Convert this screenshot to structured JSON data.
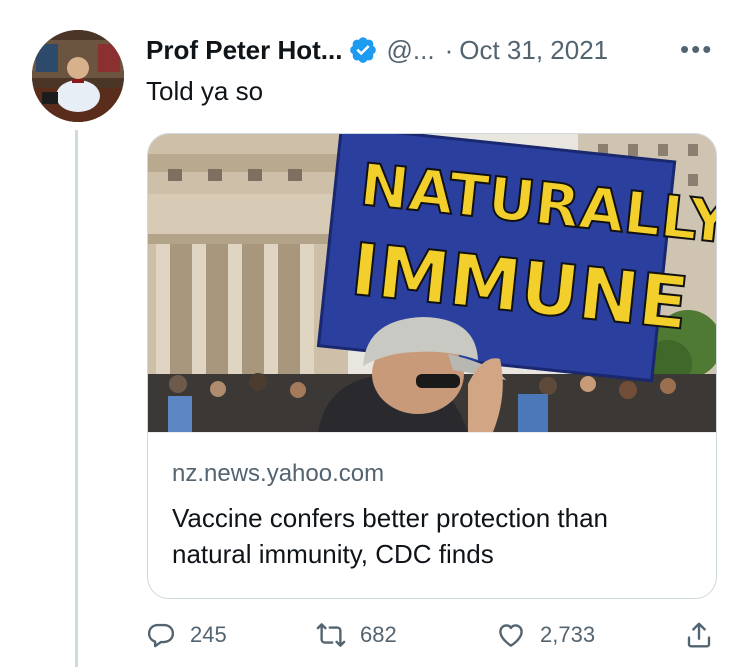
{
  "tweet": {
    "author_name": "Prof Peter Hot...",
    "handle": "@...",
    "separator": "·",
    "date": "Oct 31, 2021",
    "more_label": "•••",
    "text": "Told ya so"
  },
  "card": {
    "sign_line1": "NATURALLY",
    "sign_line2": "IMMUNE",
    "domain": "nz.news.yahoo.com",
    "title": "Vaccine confers better protection than natural immunity, CDC finds"
  },
  "actions": {
    "replies": "245",
    "retweets": "682",
    "likes": "2,733"
  },
  "colors": {
    "verified": "#1d9bf0",
    "secondary_text": "#536471",
    "border": "#cfd9de",
    "sign_blue": "#2a3f9e",
    "sign_yellow": "#f2cf2a"
  },
  "icons": [
    "verified-badge-icon",
    "more-icon",
    "reply-icon",
    "retweet-icon",
    "like-icon",
    "share-icon"
  ]
}
